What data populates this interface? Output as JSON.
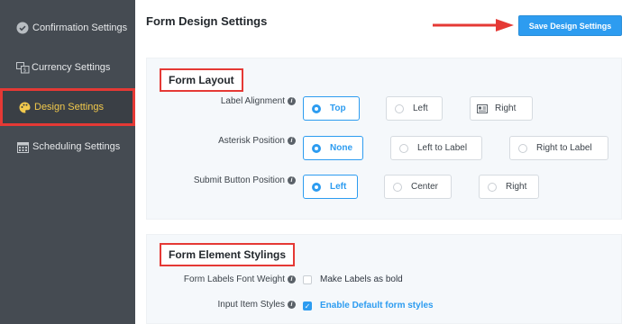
{
  "sidebar": {
    "items": [
      {
        "label": "Confirmation Settings",
        "icon": "check-circle-icon"
      },
      {
        "label": "Currency Settings",
        "icon": "currency-icon"
      },
      {
        "label": "Design Settings",
        "icon": "palette-icon",
        "active": true
      },
      {
        "label": "Scheduling Settings",
        "icon": "calendar-icon"
      }
    ]
  },
  "header": {
    "title": "Form Design Settings",
    "save_label": "Save Design Settings"
  },
  "form_layout": {
    "title": "Form Layout",
    "label_alignment": {
      "label": "Label Alignment",
      "options": [
        "Top",
        "Left",
        "Right"
      ],
      "selected": "Top"
    },
    "asterisk_position": {
      "label": "Asterisk Position",
      "options": [
        "None",
        "Left to Label",
        "Right to Label"
      ],
      "selected": "None"
    },
    "submit_button_position": {
      "label": "Submit Button Position",
      "options": [
        "Left",
        "Center",
        "Right"
      ],
      "selected": "Left"
    }
  },
  "element_stylings": {
    "title": "Form Element Stylings",
    "font_weight": {
      "label": "Form Labels Font Weight",
      "checkbox_label": "Make Labels as bold",
      "checked": false
    },
    "input_styles": {
      "label": "Input Item Styles",
      "checkbox_label": "Enable Default form styles",
      "checked": true
    }
  },
  "colors": {
    "accent": "#2d9cf0",
    "sidebar_bg": "#454b52",
    "active_text": "#f2c94c",
    "highlight_red": "#e53935"
  }
}
